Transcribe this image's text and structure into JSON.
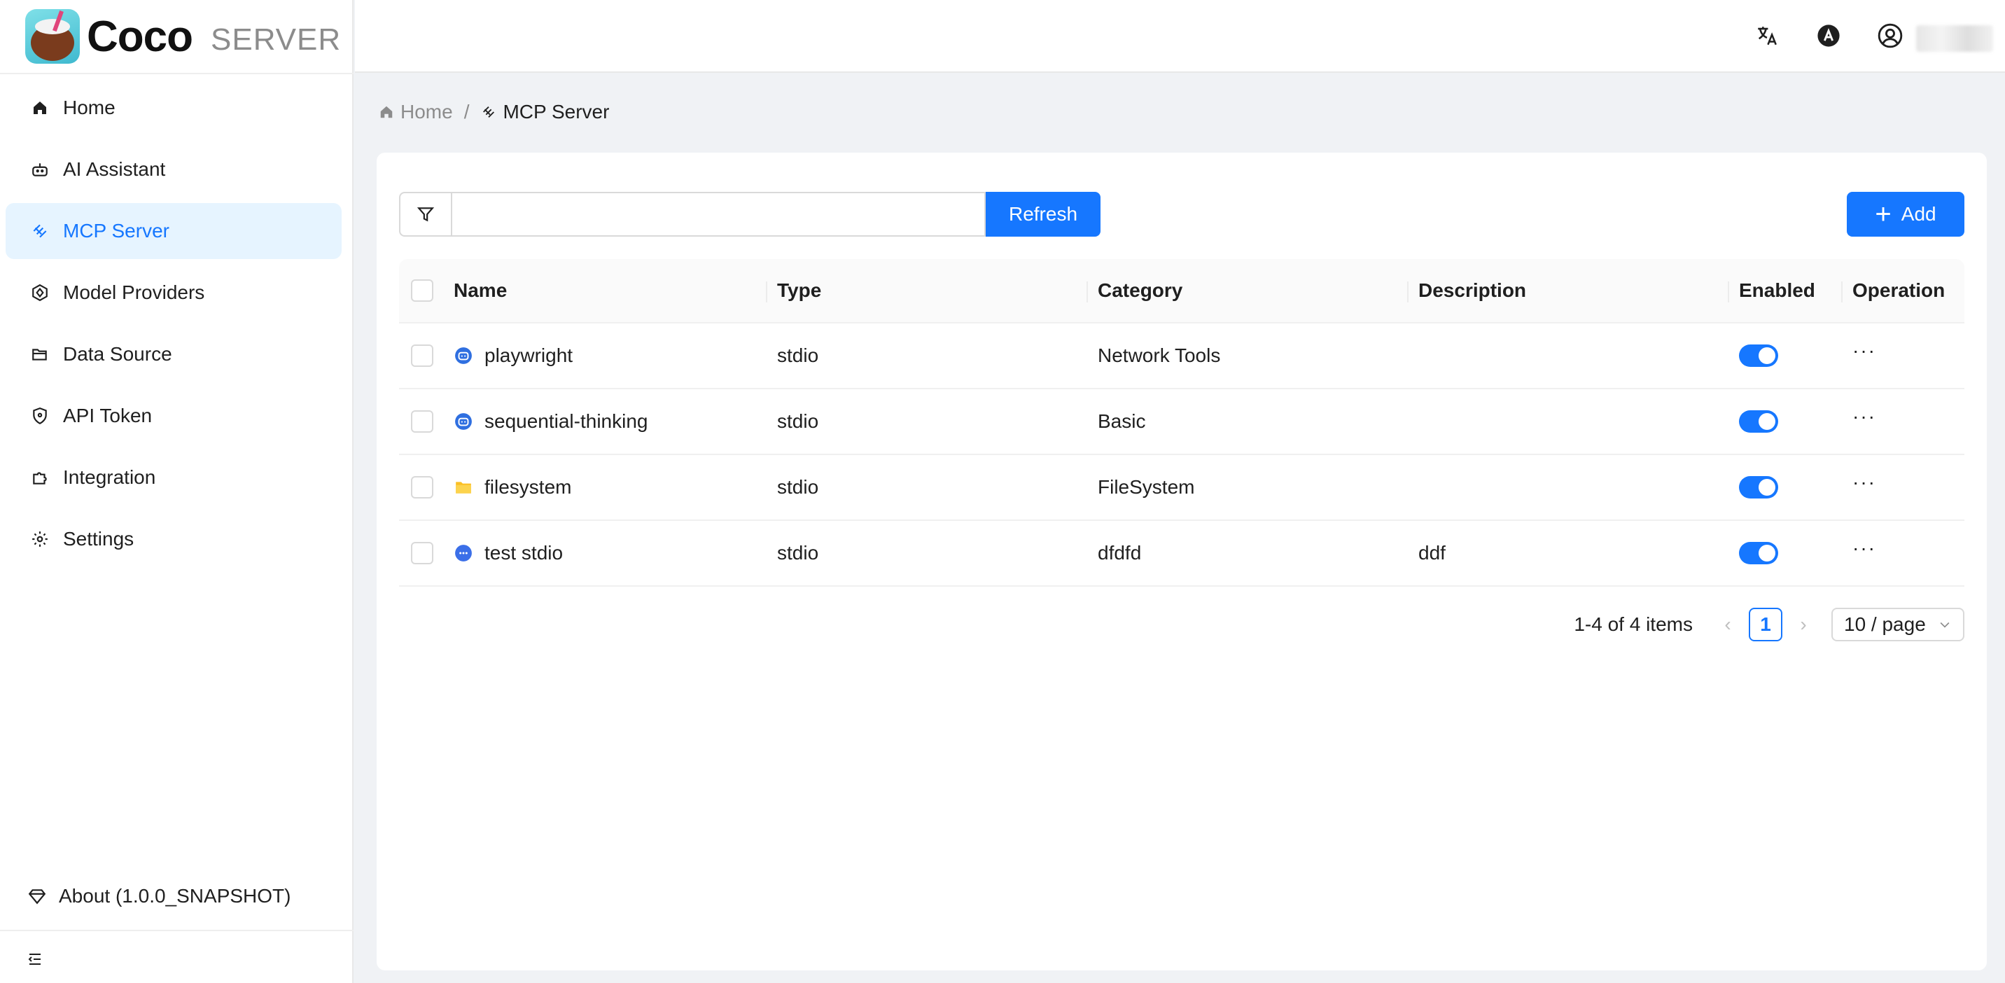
{
  "brand": {
    "name": "Coco",
    "subtitle": "SERVER"
  },
  "sidebar": {
    "items": [
      {
        "label": "Home",
        "icon": "home-icon"
      },
      {
        "label": "AI Assistant",
        "icon": "robot-icon"
      },
      {
        "label": "MCP Server",
        "icon": "mcp-icon",
        "active": true
      },
      {
        "label": "Model Providers",
        "icon": "model-icon"
      },
      {
        "label": "Data Source",
        "icon": "folder-open-icon"
      },
      {
        "label": "API Token",
        "icon": "shield-icon"
      },
      {
        "label": "Integration",
        "icon": "puzzle-icon"
      },
      {
        "label": "Settings",
        "icon": "gear-icon"
      }
    ],
    "about": "About (1.0.0_SNAPSHOT)"
  },
  "header": {
    "icons": [
      "translate-icon",
      "theme-icon",
      "user-icon"
    ]
  },
  "breadcrumb": {
    "home": "Home",
    "separator": "/",
    "current": "MCP Server"
  },
  "toolbar": {
    "search_value": "",
    "refresh_label": "Refresh",
    "add_label": "Add"
  },
  "table": {
    "columns": {
      "name": "Name",
      "type": "Type",
      "category": "Category",
      "description": "Description",
      "enabled": "Enabled",
      "operation": "Operation"
    },
    "rows": [
      {
        "name": "playwright",
        "icon": "robot-icon",
        "type": "stdio",
        "category": "Network Tools",
        "description": "",
        "enabled": true
      },
      {
        "name": "sequential-thinking",
        "icon": "robot-icon",
        "type": "stdio",
        "category": "Basic",
        "description": "",
        "enabled": true
      },
      {
        "name": "filesystem",
        "icon": "folder-icon",
        "type": "stdio",
        "category": "FileSystem",
        "description": "",
        "enabled": true
      },
      {
        "name": "test stdio",
        "icon": "chat-icon",
        "type": "stdio",
        "category": "dfdfd",
        "description": "ddf",
        "enabled": true
      }
    ],
    "row_operation": "···"
  },
  "pagination": {
    "total_text": "1-4 of 4 items",
    "current_page": "1",
    "page_size": "10 / page"
  },
  "colors": {
    "primary": "#1677ff",
    "active_bg": "#e6f4ff",
    "folder": "#fbbf24"
  }
}
